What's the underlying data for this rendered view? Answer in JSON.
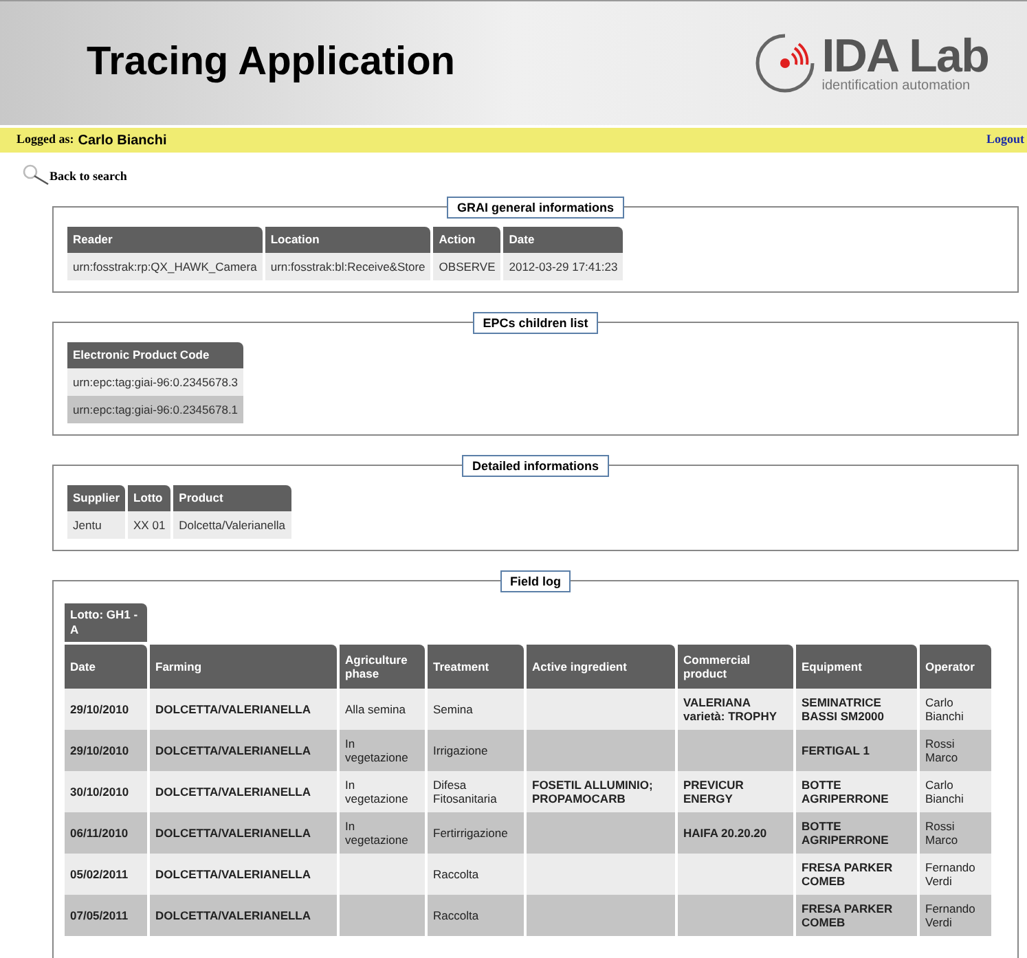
{
  "header": {
    "title": "Tracing Application",
    "logo_name": "IDA Lab",
    "logo_tagline": "identification automation"
  },
  "user_bar": {
    "label": "Logged as:",
    "user": "Carlo Bianchi",
    "logout": "Logout"
  },
  "back_link": "Back to search",
  "sections": [
    {
      "legend": "GRAI general informations",
      "columns": [
        "Reader",
        "Location",
        "Action",
        "Date"
      ],
      "rows": [
        [
          "urn:fosstrak:rp:QX_HAWK_Camera",
          "urn:fosstrak:bl:Receive&Store",
          "OBSERVE",
          "2012-03-29 17:41:23"
        ]
      ]
    },
    {
      "legend": "EPCs children list",
      "columns": [
        "Electronic Product Code"
      ],
      "rows": [
        [
          "urn:epc:tag:giai-96:0.2345678.3"
        ],
        [
          "urn:epc:tag:giai-96:0.2345678.1"
        ]
      ]
    },
    {
      "legend": "Detailed informations",
      "columns": [
        "Supplier",
        "Lotto",
        "Product"
      ],
      "rows": [
        [
          "Jentu",
          "XX 01",
          "Dolcetta/Valerianella"
        ]
      ]
    }
  ],
  "field_log": {
    "legend": "Field log",
    "tab": "Lotto: GH1 - A",
    "columns": [
      "Date",
      "Farming",
      "Agriculture phase",
      "Treatment",
      "Active ingredient",
      "Commercial product",
      "Equipment",
      "Operator"
    ],
    "rows": [
      [
        "29/10/2010",
        "DOLCETTA/VALERIANELLA",
        "Alla semina",
        "Semina",
        "",
        "VALERIANA varietà: TROPHY",
        "SEMINATRICE BASSI SM2000",
        "Carlo Bianchi"
      ],
      [
        "29/10/2010",
        "DOLCETTA/VALERIANELLA",
        "In vegetazione",
        "Irrigazione",
        "",
        "",
        "FERTIGAL 1",
        "Rossi Marco"
      ],
      [
        "30/10/2010",
        "DOLCETTA/VALERIANELLA",
        "In vegetazione",
        "Difesa Fitosanitaria",
        "FOSETIL ALLUMINIO; PROPAMOCARB",
        "PREVICUR ENERGY",
        "BOTTE AGRIPERRONE",
        "Carlo Bianchi"
      ],
      [
        "06/11/2010",
        "DOLCETTA/VALERIANELLA",
        "In vegetazione",
        "Fertirrigazione",
        "",
        "HAIFA 20.20.20",
        "BOTTE AGRIPERRONE",
        "Rossi Marco"
      ],
      [
        "05/02/2011",
        "DOLCETTA/VALERIANELLA",
        "",
        "Raccolta",
        "",
        "",
        "FRESA PARKER COMEB",
        "Fernando Verdi"
      ],
      [
        "07/05/2011",
        "DOLCETTA/VALERIANELLA",
        "",
        "Raccolta",
        "",
        "",
        "FRESA PARKER COMEB",
        "Fernando Verdi"
      ]
    ]
  }
}
